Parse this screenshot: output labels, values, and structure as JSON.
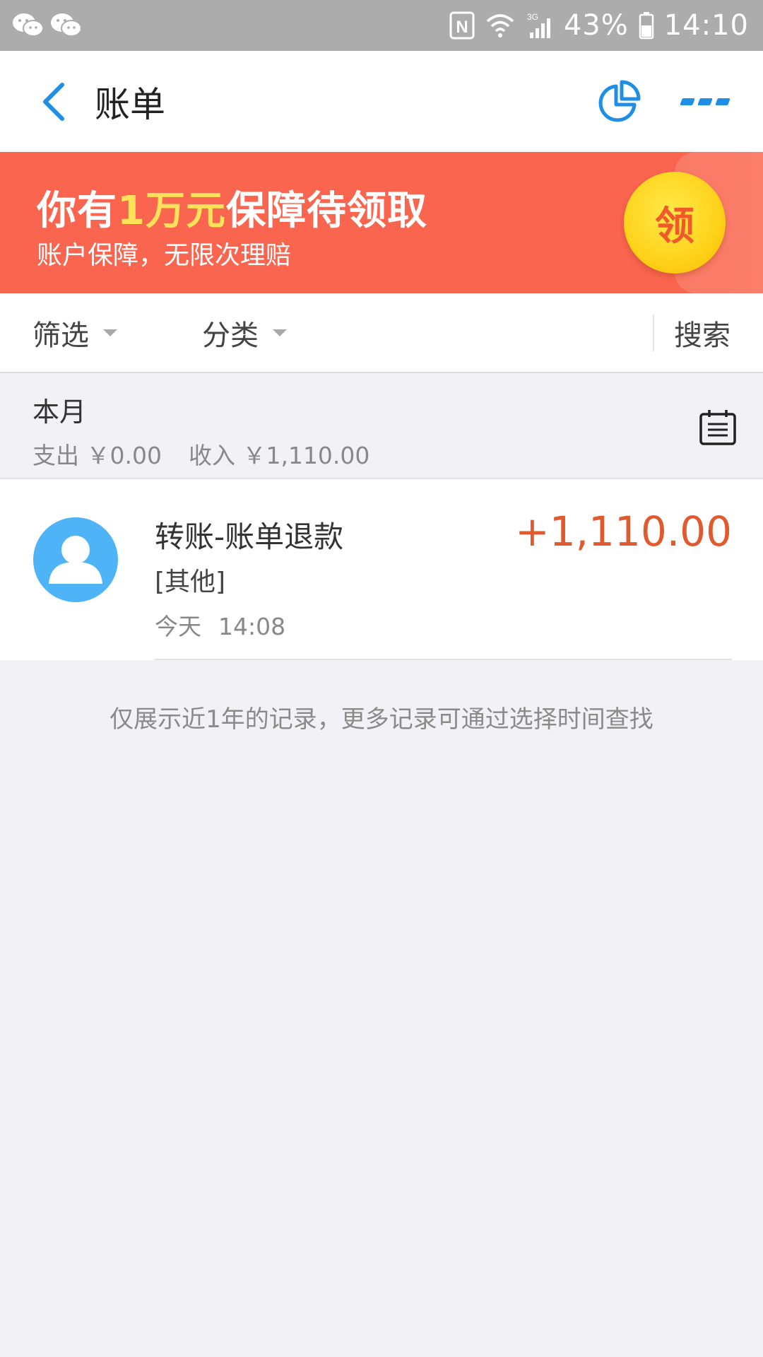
{
  "status_bar": {
    "left_icons": [
      "wechat-icon",
      "wechat-icon"
    ],
    "nfc": "N",
    "network": "3G",
    "battery": "43%",
    "time": "14:10"
  },
  "header": {
    "title": "账单",
    "icons": [
      "back-arrow-icon",
      "pie-chart-icon",
      "more-icon"
    ]
  },
  "banner": {
    "title_pre": "你有",
    "title_highlight": "1万元",
    "title_post": "保障待领取",
    "subtitle": "账户保障，无限次理赔",
    "coin_label": "领"
  },
  "filters": {
    "screen_label": "筛选",
    "category_label": "分类",
    "search_label": "搜索"
  },
  "month": {
    "title": "本月",
    "expense": "支出 ￥0.00",
    "income": "收入 ￥1,110.00"
  },
  "record": {
    "title": "转账-账单退款",
    "category": "[其他]",
    "day": "今天",
    "time": "14:08",
    "amount": "+1,110.00"
  },
  "footer_note": "仅展示近1年的记录，更多记录可通过选择时间查找",
  "colors": {
    "accent_blue": "#1f8fe5",
    "banner_red": "#f9654f",
    "amount_orange": "#e15a2d",
    "avatar_blue": "#4fb3f8"
  }
}
